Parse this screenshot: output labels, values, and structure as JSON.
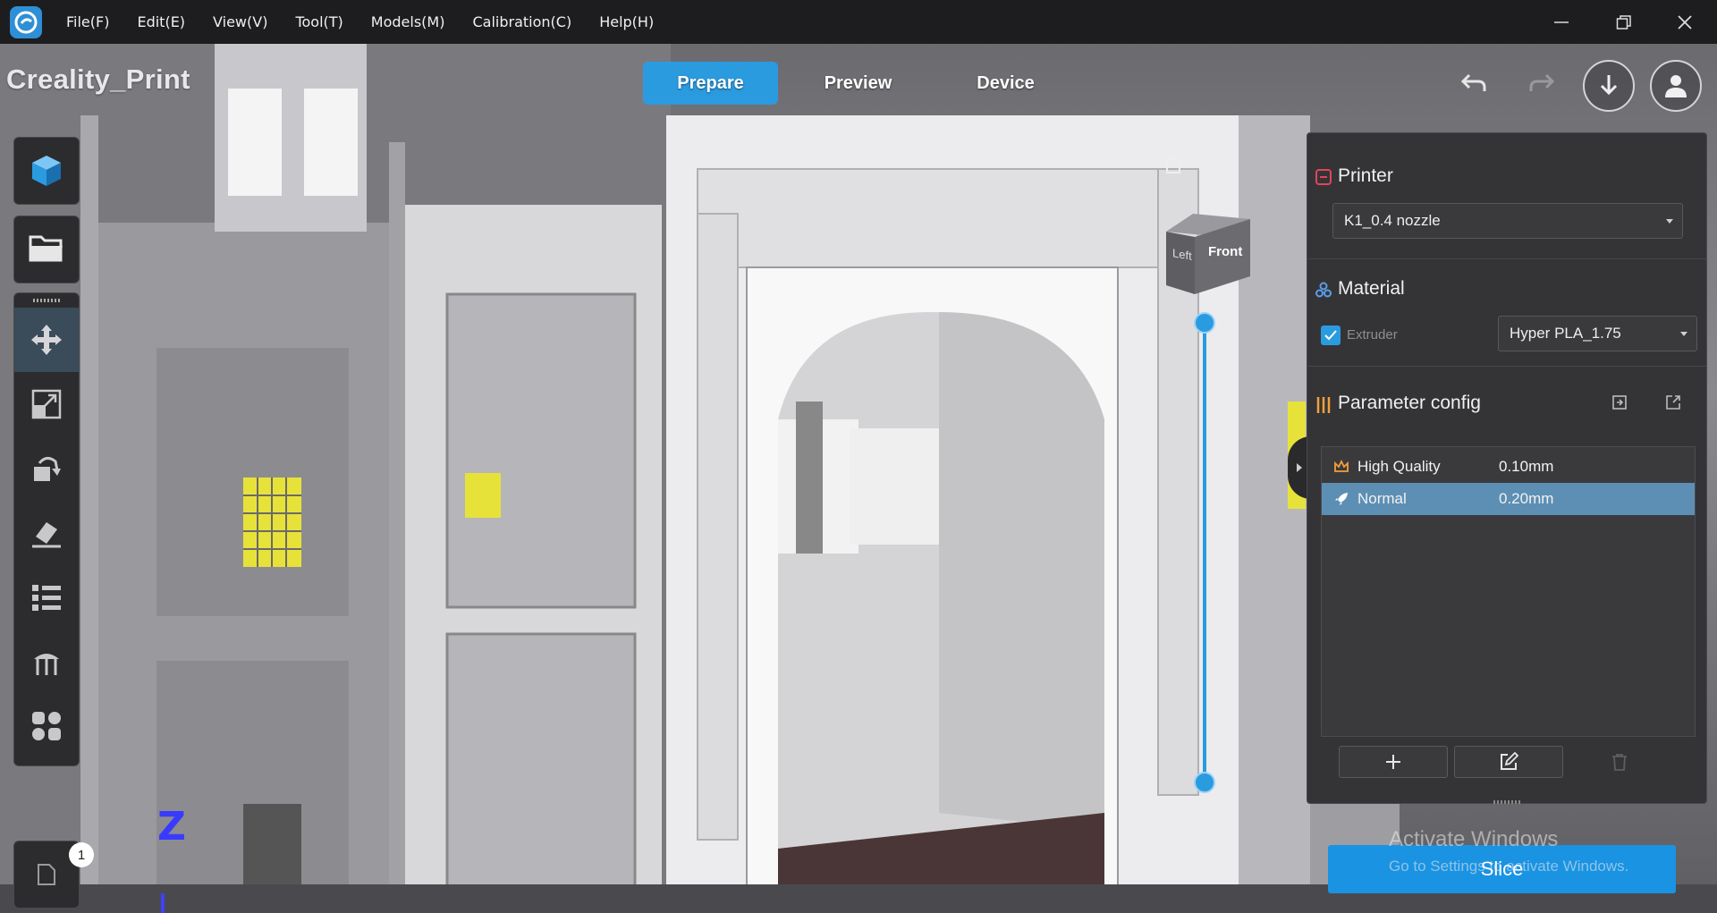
{
  "app": {
    "title": "Creality_Print",
    "brand_color": "#2b9be0"
  },
  "menubar": {
    "menus": [
      "File(F)",
      "Edit(E)",
      "View(V)",
      "Tool(T)",
      "Models(M)",
      "Calibration(C)",
      "Help(H)"
    ]
  },
  "mode_tabs": {
    "prepare": "Prepare",
    "preview": "Preview",
    "device": "Device",
    "active": "Prepare"
  },
  "view_cube": {
    "left": "Left",
    "front": "Front"
  },
  "right_panel": {
    "printer": {
      "title": "Printer",
      "selected": "K1_0.4 nozzle"
    },
    "material": {
      "title": "Material",
      "extruder_label": "Extruder",
      "extruder_checked": true,
      "selected": "Hyper PLA_1.75"
    },
    "parameter_config": {
      "title": "Parameter config",
      "rows": [
        {
          "name": "High Quality",
          "value": "0.10mm",
          "icon": "crown-icon",
          "selected": false
        },
        {
          "name": "Normal",
          "value": "0.20mm",
          "icon": "rocket-icon",
          "selected": true
        }
      ]
    }
  },
  "slice_button": "Slice",
  "object_count": "1",
  "axis_label": "Z",
  "activation": {
    "line1": "Activate Windows",
    "line2": "Go to Settings to activate Windows."
  },
  "left_toolbar": [
    "add-model-icon",
    "open-folder-icon",
    "move-icon",
    "scale-icon",
    "rotate-icon",
    "lay-flat-icon",
    "list-icon",
    "support-icon",
    "arrange-icon"
  ]
}
